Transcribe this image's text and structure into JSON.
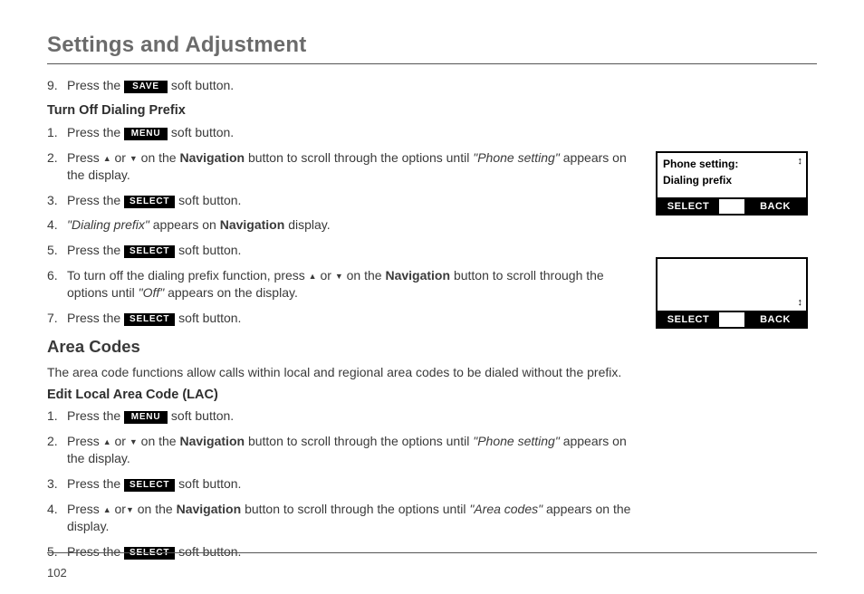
{
  "page_title": "Settings and Adjustment",
  "page_number": "102",
  "labels": {
    "save": "SAVE",
    "menu": "MENU",
    "select": "SELECT",
    "back": "BACK",
    "navigation": "Navigation",
    "up": "▲",
    "down": "▼",
    "scroll": "↕"
  },
  "section1": {
    "step9_a": "Press the",
    "step9_b": "soft button.",
    "heading": "Turn Off Dialing Prefix",
    "s1_a": "Press the",
    "s1_b": "soft button.",
    "s2_a": "Press",
    "s2_b": "or",
    "s2_c": "on the",
    "s2_d": "button to scroll through the options until",
    "s2_e": "\"Phone setting\"",
    "s2_f": "appears on the display.",
    "s3_a": "Press the",
    "s3_b": "soft button.",
    "s4_a": "\"Dialing prefix\"",
    "s4_b": "appears on",
    "s4_c": "display.",
    "s5_a": "Press the",
    "s5_b": "soft button.",
    "s6_a": "To turn off the dialing prefix function, press",
    "s6_b": "or",
    "s6_c": "on the",
    "s6_d": "button to scroll through the options until",
    "s6_e": "\"Off\"",
    "s6_f": "appears on the display.",
    "s7_a": "Press the",
    "s7_b": "soft button."
  },
  "section2": {
    "heading": "Area Codes",
    "intro": "The area code functions allow calls within local and regional area codes to be dialed without the prefix.",
    "subheading": "Edit Local Area Code (LAC)",
    "s1_a": "Press the",
    "s1_b": "soft button.",
    "s2_a": "Press",
    "s2_b": "or",
    "s2_c": "on the",
    "s2_d": "button to scroll through the options until",
    "s2_e": "\"Phone setting\"",
    "s2_f": "appears on the display.",
    "s3_a": "Press the",
    "s3_b": "soft button.",
    "s4_a": "Press",
    "s4_b": "or",
    "s4_c": "on the",
    "s4_d": "button to scroll through the options until",
    "s4_e": "\"Area codes\"",
    "s4_f": "appears on the display.",
    "s5_a": "Press the",
    "s5_b": "soft button."
  },
  "screens": {
    "top": {
      "line1": "Phone setting:",
      "line2": "Dialing prefix"
    },
    "bottom": {}
  }
}
